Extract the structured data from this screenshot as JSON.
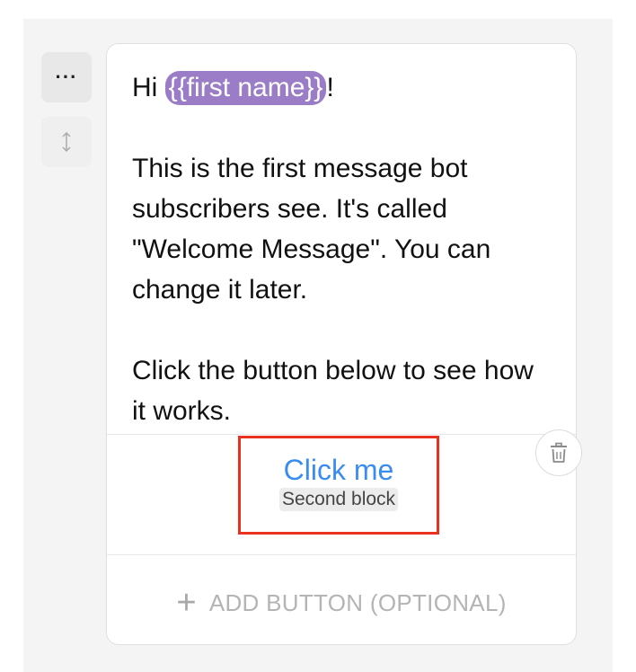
{
  "sidebar": {
    "menu_icon": "more-horizontal-icon",
    "menu_label": "···",
    "drag_icon": "drag-vertical-icon"
  },
  "card": {
    "greeting_prefix": "Hi ",
    "variable": "{{first name}}",
    "greeting_suffix": "!",
    "paragraph_1": "This is the first message bot subscribers see. It's called \"Welcome Message\". You can change it later.",
    "paragraph_2": "Click the button below to see how it works.",
    "button": {
      "title": "Click me",
      "target_block": "Second block"
    },
    "add_button_label": "ADD BUTTON (OPTIONAL)",
    "delete_icon": "trash-icon"
  },
  "colors": {
    "accent_link": "#3a8df0",
    "variable_pill": "#9a7dc6",
    "highlight_box": "#e8321f"
  }
}
